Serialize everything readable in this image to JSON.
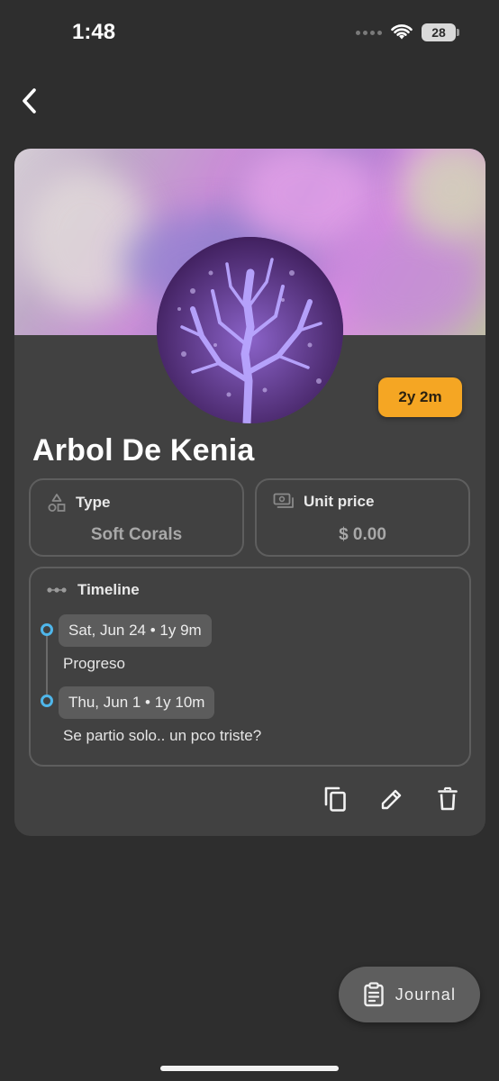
{
  "status_bar": {
    "time": "1:48",
    "battery": "28"
  },
  "coral": {
    "name": "Arbol De Kenia",
    "age": "2y 2m"
  },
  "info": {
    "type_label": "Type",
    "type_value": "Soft Corals",
    "price_label": "Unit price",
    "price_value": "$ 0.00"
  },
  "timeline": {
    "title": "Timeline",
    "entries": [
      {
        "date": "Sat, Jun 24 • 1y 9m",
        "note": "Progreso"
      },
      {
        "date": "Thu, Jun 1 • 1y 10m",
        "note": "Se partio solo.. un pco triste?"
      }
    ]
  },
  "actions": {
    "icons": [
      "copy-icon",
      "edit-icon",
      "delete-icon"
    ]
  },
  "journal_button": {
    "label": "Journal"
  },
  "colors": {
    "accent": "#f5a623",
    "timeline_dot": "#4fb6ea",
    "background": "#2e2e2e",
    "card": "#414141"
  }
}
